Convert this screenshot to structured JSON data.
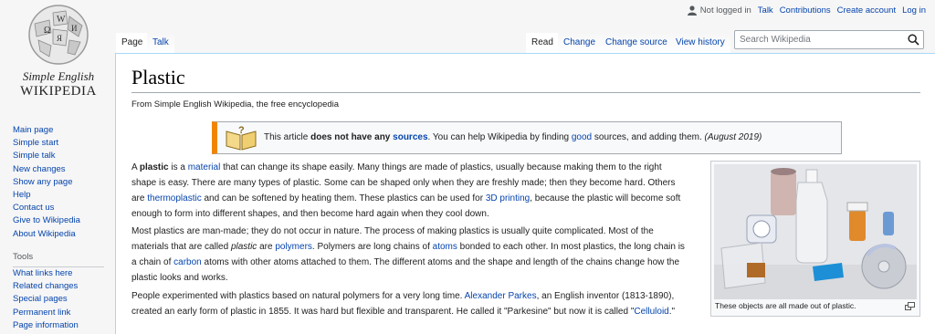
{
  "logo": {
    "line1": "Simple English",
    "line2": "WIKIPEDIA"
  },
  "sidebar": {
    "nav": [
      "Main page",
      "Simple start",
      "Simple talk",
      "New changes",
      "Show any page",
      "Help",
      "Contact us",
      "Give to Wikipedia",
      "About Wikipedia"
    ],
    "tools_heading": "Tools",
    "tools": [
      "What links here",
      "Related changes",
      "Special pages",
      "Permanent link",
      "Page information"
    ]
  },
  "personal": {
    "not_logged_in": "Not logged in",
    "talk": "Talk",
    "contributions": "Contributions",
    "create_account": "Create account",
    "login": "Log in"
  },
  "tabs": {
    "page": "Page",
    "talk": "Talk",
    "read": "Read",
    "change": "Change",
    "change_source": "Change source",
    "view_history": "View history"
  },
  "search": {
    "placeholder": "Search Wikipedia"
  },
  "article": {
    "title": "Plastic",
    "tagline": "From Simple English Wikipedia, the free encyclopedia",
    "ambox": {
      "t1": "This article ",
      "t2": "does not have any ",
      "t3": "sources",
      "t4": ". You can help Wikipedia by finding ",
      "t5": "good",
      "t6": " sources, and adding them. ",
      "t7": "(August 2019)"
    },
    "p1": {
      "a": "A ",
      "b": "plastic",
      "c": " is a ",
      "d": "material",
      "e": " that can change its shape easily. Many things are made of plastics, usually because making them to the right shape is easy. There are many types of plastic. Some can be shaped only when they are freshly made; then they become hard. Others are ",
      "f": "thermoplastic",
      "g": " and can be softened by heating them. These plastics can be used for ",
      "h": "3D printing",
      "i": ", because the plastic will become soft enough to form into different shapes, and then become hard again when they cool down."
    },
    "p2": {
      "a": "Most plastics are man-made; they do not occur in nature. The process of making plastics is usually quite complicated. Most of the materials that are called ",
      "b": "plastic",
      "c": " are ",
      "d": "polymers",
      "e": ". Polymers are long chains of ",
      "f": "atoms",
      "g": " bonded to each other. In most plastics, the long chain is a chain of ",
      "h": "carbon",
      "i": " atoms with other atoms attached to them. The different atoms and the shape and length of the chains change how the plastic looks and works."
    },
    "p3": {
      "a": "People experimented with plastics based on natural polymers for a very long time. ",
      "b": "Alexander Parkes",
      "c": ", an English inventor (1813-1890), created an early form of plastic in 1855. It was hard but flexible and transparent. He called it \"Parkesine\" but now it is called \"",
      "d": "Celluloid",
      "e": ".\""
    },
    "caption": "These objects are all made out of plastic."
  }
}
